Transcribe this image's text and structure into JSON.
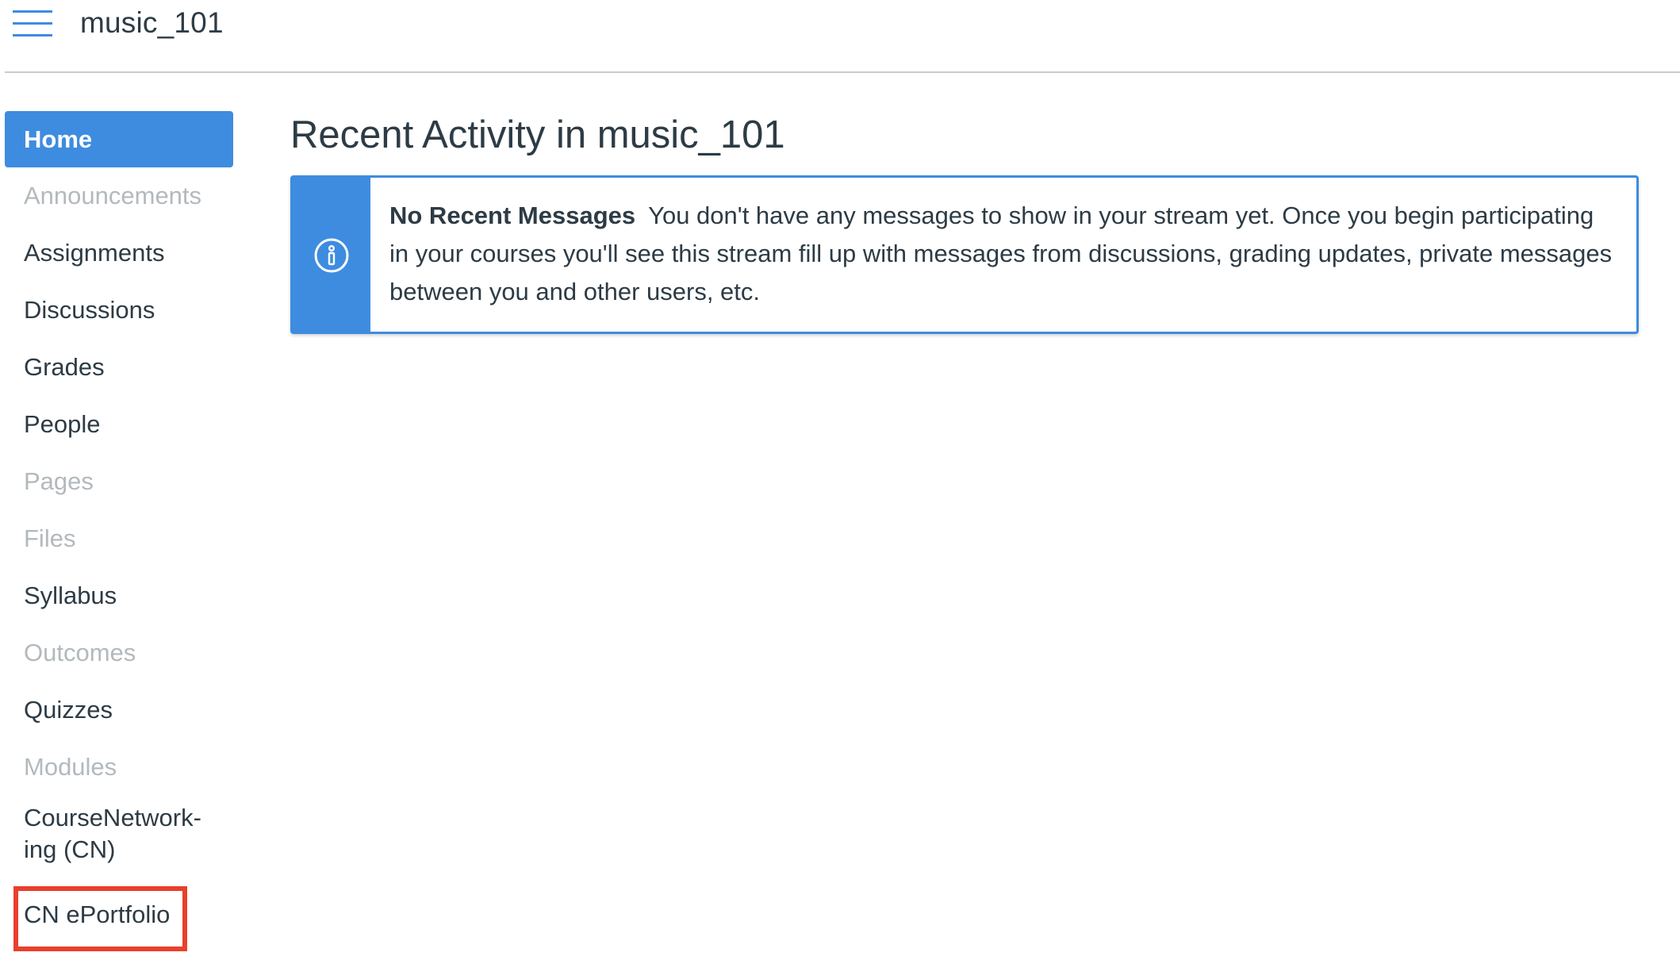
{
  "header": {
    "course_name": "music_101",
    "menu_icon": "hamburger-menu-icon"
  },
  "sidebar": {
    "items": [
      {
        "label": "Home",
        "state": "active"
      },
      {
        "label": "Announcements",
        "state": "disabled"
      },
      {
        "label": "Assignments",
        "state": "enabled"
      },
      {
        "label": "Discussions",
        "state": "enabled"
      },
      {
        "label": "Grades",
        "state": "enabled"
      },
      {
        "label": "People",
        "state": "enabled"
      },
      {
        "label": "Pages",
        "state": "disabled"
      },
      {
        "label": "Files",
        "state": "disabled"
      },
      {
        "label": "Syllabus",
        "state": "enabled"
      },
      {
        "label": "Outcomes",
        "state": "disabled"
      },
      {
        "label": "Quizzes",
        "state": "enabled"
      },
      {
        "label": "Modules",
        "state": "disabled"
      },
      {
        "label_line1": "CourseNetwork-",
        "label_line2": "ing (CN)",
        "state": "enabled"
      },
      {
        "label": "CN ePortfolio",
        "state": "highlighted"
      }
    ]
  },
  "main": {
    "title": "Recent Activity in music_101",
    "alert": {
      "icon": "info-icon",
      "heading": "No Recent Messages",
      "message": "You don't have any messages to show in your stream yet. Once you begin participating in your courses you'll see this stream fill up with messages from discussions, grading updates, private messages between you and other users, etc."
    }
  },
  "colors": {
    "accent": "#3e8ce0",
    "text": "#2d3b45",
    "disabled_text": "#b3b9bd",
    "highlight_border": "#e8402c"
  }
}
